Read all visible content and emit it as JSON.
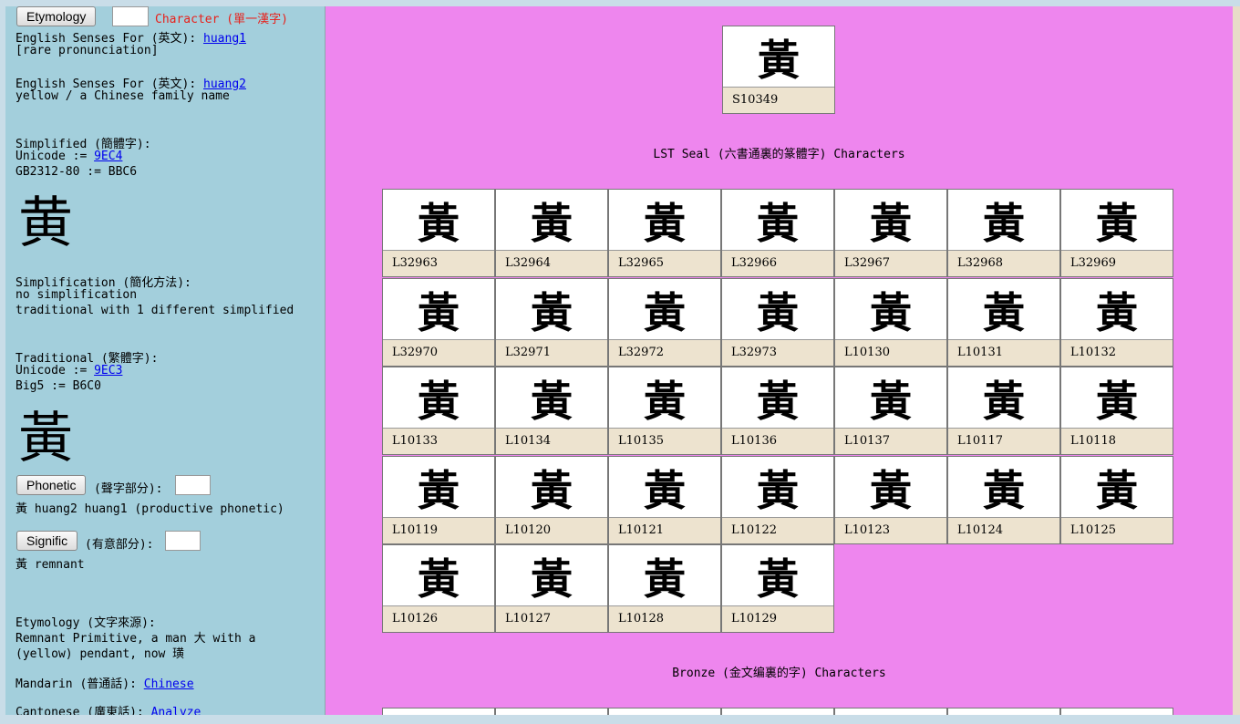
{
  "left": {
    "etymology_button": "Etymology",
    "character_label": "Character (單一漢字)",
    "senses1_label": "English Senses For (英文): ",
    "senses1_link": "huang1",
    "senses1_text": "[rare pronunciation]",
    "senses2_label": "English Senses For (英文): ",
    "senses2_link": "huang2",
    "senses2_text": "yellow / a Chinese family name",
    "simplified_label": "Simplified (簡體字):",
    "simplified_unicode_label": "Unicode := ",
    "simplified_unicode_link": "9EC4",
    "simplified_gb": "GB2312-80 := BBC6",
    "simplified_glyph": "黄",
    "simplification_label": "Simplification (簡化方法):",
    "simplification_line1": "no simplification",
    "simplification_line2": "traditional with 1 different simplified",
    "traditional_label": "Traditional (繁體字):",
    "traditional_unicode_label": "Unicode := ",
    "traditional_unicode_link": "9EC3",
    "traditional_big5": "Big5 := B6C0",
    "traditional_glyph": "黃",
    "phonetic_button": "Phonetic",
    "phonetic_label": "(聲字部分):",
    "phonetic_text": "黃 huang2 huang1 (productive phonetic)",
    "signific_button": "Signific",
    "signific_label": "(有意部分):",
    "signific_text": "黃 remnant",
    "etymology_label": "Etymology (文字來源):",
    "etymology_line1": "Remnant Primitive, a man 大 with a",
    "etymology_line2": "(yellow) pendant, now 璜",
    "mandarin_label": "Mandarin (普通話): ",
    "mandarin_link": "Chinese",
    "cantonese_label": "Cantonese (廣東話): ",
    "cantonese_link": "Analyze"
  },
  "right": {
    "top_cell": {
      "glyph": "黃",
      "code": "S10349"
    },
    "seal_heading": "LST Seal (六書通裏的篆體字) Characters",
    "bronze_heading": "Bronze (金文编裏的字) Characters",
    "seal_cells": [
      {
        "glyph": "黃",
        "code": "L32963"
      },
      {
        "glyph": "黃",
        "code": "L32964"
      },
      {
        "glyph": "黃",
        "code": "L32965"
      },
      {
        "glyph": "黃",
        "code": "L32966"
      },
      {
        "glyph": "黃",
        "code": "L32967"
      },
      {
        "glyph": "黃",
        "code": "L32968"
      },
      {
        "glyph": "黃",
        "code": "L32969"
      },
      {
        "glyph": "黃",
        "code": "L32970"
      },
      {
        "glyph": "黃",
        "code": "L32971"
      },
      {
        "glyph": "黃",
        "code": "L32972"
      },
      {
        "glyph": "黃",
        "code": "L32973"
      },
      {
        "glyph": "黃",
        "code": "L10130"
      },
      {
        "glyph": "黃",
        "code": "L10131"
      },
      {
        "glyph": "黃",
        "code": "L10132"
      },
      {
        "glyph": "黃",
        "code": "L10133"
      },
      {
        "glyph": "黃",
        "code": "L10134"
      },
      {
        "glyph": "黃",
        "code": "L10135"
      },
      {
        "glyph": "黃",
        "code": "L10136"
      },
      {
        "glyph": "黃",
        "code": "L10137"
      },
      {
        "glyph": "黃",
        "code": "L10117"
      },
      {
        "glyph": "黃",
        "code": "L10118"
      },
      {
        "glyph": "黃",
        "code": "L10119"
      },
      {
        "glyph": "黃",
        "code": "L10120"
      },
      {
        "glyph": "黃",
        "code": "L10121"
      },
      {
        "glyph": "黃",
        "code": "L10122"
      },
      {
        "glyph": "黃",
        "code": "L10123"
      },
      {
        "glyph": "黃",
        "code": "L10124"
      },
      {
        "glyph": "黃",
        "code": "L10125"
      },
      {
        "glyph": "黃",
        "code": "L10126"
      },
      {
        "glyph": "黃",
        "code": "L10127"
      },
      {
        "glyph": "黃",
        "code": "L10128"
      },
      {
        "glyph": "黃",
        "code": "L10129"
      }
    ]
  }
}
